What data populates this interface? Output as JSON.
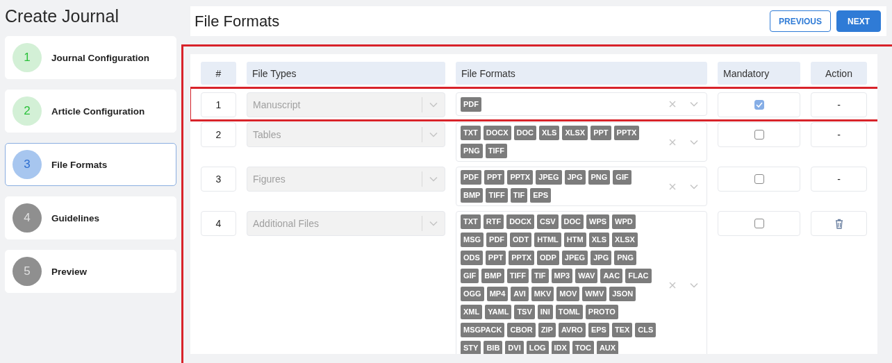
{
  "page_title": "Create Journal",
  "steps": [
    {
      "number": "1",
      "label": "Journal Configuration",
      "kind": "completed",
      "selected": false
    },
    {
      "number": "2",
      "label": "Article Configuration",
      "kind": "completed",
      "selected": false
    },
    {
      "number": "3",
      "label": "File Formats",
      "kind": "current",
      "selected": true
    },
    {
      "number": "4",
      "label": "Guidelines",
      "kind": "pending",
      "selected": false
    },
    {
      "number": "5",
      "label": "Preview",
      "kind": "pending",
      "selected": false
    }
  ],
  "header": {
    "title": "File Formats",
    "buttons": [
      {
        "label": "PREVIOUS",
        "kind": "outline"
      },
      {
        "label": "NEXT",
        "kind": "primary"
      }
    ]
  },
  "table": {
    "highlighted": true,
    "columns": [
      "#",
      "File Types",
      "File Formats",
      "Mandatory",
      "Action"
    ],
    "rows": [
      {
        "number": "1",
        "file_type": "Manuscript",
        "highlighted": true,
        "mandatory": true,
        "action": {
          "kind": "text",
          "text": "-"
        },
        "formats": [
          "PDF"
        ]
      },
      {
        "number": "2",
        "file_type": "Tables",
        "highlighted": false,
        "mandatory": false,
        "action": {
          "kind": "text",
          "text": "-"
        },
        "formats": [
          "TXT",
          "DOCX",
          "DOC",
          "XLS",
          "XLSX",
          "PPT",
          "PPTX",
          "PNG",
          "TIFF"
        ]
      },
      {
        "number": "3",
        "file_type": "Figures",
        "highlighted": false,
        "mandatory": false,
        "action": {
          "kind": "text",
          "text": "-"
        },
        "formats": [
          "PDF",
          "PPT",
          "PPTX",
          "JPEG",
          "JPG",
          "PNG",
          "GIF",
          "BMP",
          "TIFF",
          "TIF",
          "EPS"
        ]
      },
      {
        "number": "4",
        "file_type": "Additional Files",
        "highlighted": false,
        "mandatory": false,
        "action": {
          "kind": "delete"
        },
        "formats": [
          "TXT",
          "RTF",
          "DOCX",
          "CSV",
          "DOC",
          "WPS",
          "WPD",
          "MSG",
          "PDF",
          "ODT",
          "HTML",
          "HTM",
          "XLS",
          "XLSX",
          "ODS",
          "PPT",
          "PPTX",
          "ODP",
          "JPEG",
          "JPG",
          "PNG",
          "GIF",
          "BMP",
          "TIFF",
          "TIF",
          "MP3",
          "WAV",
          "AAC",
          "FLAC",
          "OGG",
          "MP4",
          "AVI",
          "MKV",
          "MOV",
          "WMV",
          "JSON",
          "XML",
          "YAML",
          "TSV",
          "INI",
          "TOML",
          "PROTO",
          "MSGPACK",
          "CBOR",
          "ZIP",
          "AVRO",
          "EPS",
          "TEX",
          "CLS",
          "STY",
          "BIB",
          "DVI",
          "LOG",
          "IDX",
          "TOC",
          "AUX"
        ]
      }
    ]
  }
}
